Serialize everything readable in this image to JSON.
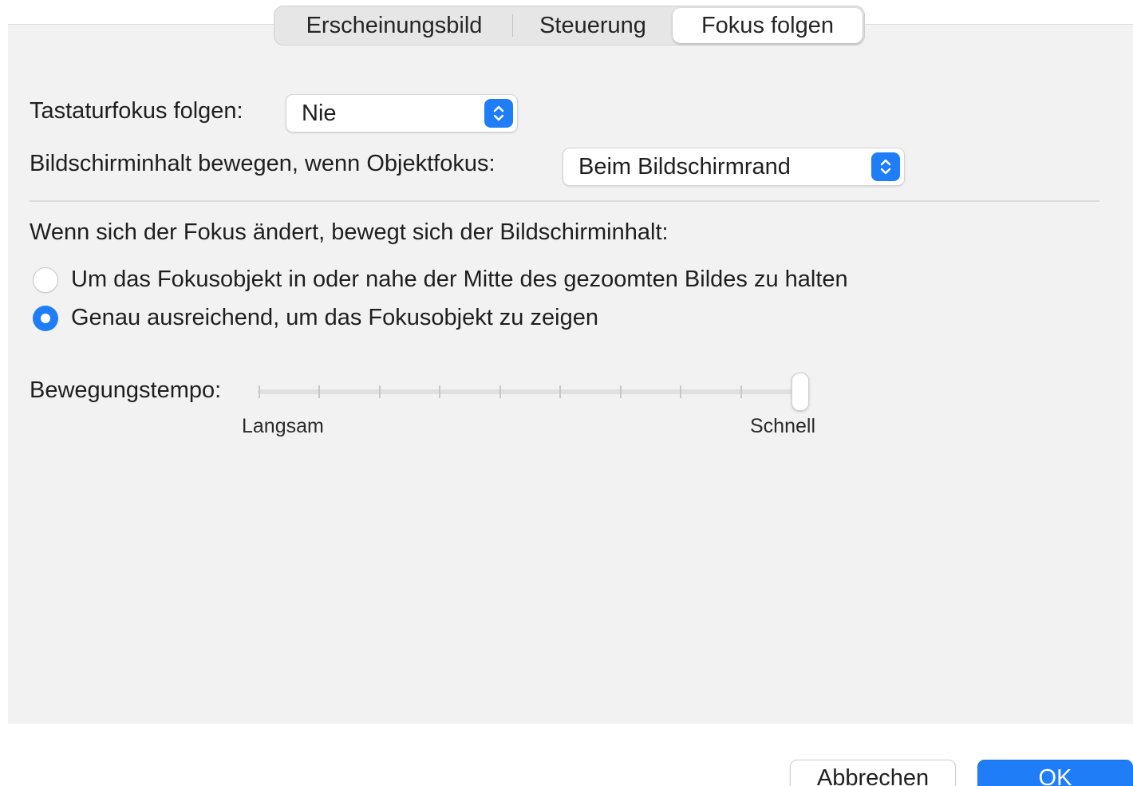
{
  "tabs": [
    {
      "label": "Erscheinungsbild",
      "selected": false
    },
    {
      "label": "Steuerung",
      "selected": false
    },
    {
      "label": "Fokus folgen",
      "selected": true
    }
  ],
  "keyboard_focus": {
    "label": "Tastaturfokus folgen:",
    "value": "Nie"
  },
  "move_screen": {
    "label": "Bildschirminhalt bewegen, wenn Objektfokus:",
    "value": "Beim Bildschirmrand"
  },
  "focus_change": {
    "heading": "Wenn sich der Fokus ändert, bewegt sich der Bildschirminhalt:",
    "options": [
      {
        "label": "Um das Fokusobjekt in oder nahe der Mitte des gezoomten Bildes zu halten",
        "selected": false
      },
      {
        "label": "Genau ausreichend, um das Fokusobjekt zu zeigen",
        "selected": true
      }
    ]
  },
  "speed": {
    "label": "Bewegungstempo:",
    "min_label": "Langsam",
    "max_label": "Schnell",
    "value_fraction": 1.0,
    "tick_count": 10
  },
  "buttons": {
    "cancel": "Abbrechen",
    "ok": "OK"
  },
  "colors": {
    "accent": "#1f7ef7",
    "panel_bg": "#f2f2f2"
  }
}
